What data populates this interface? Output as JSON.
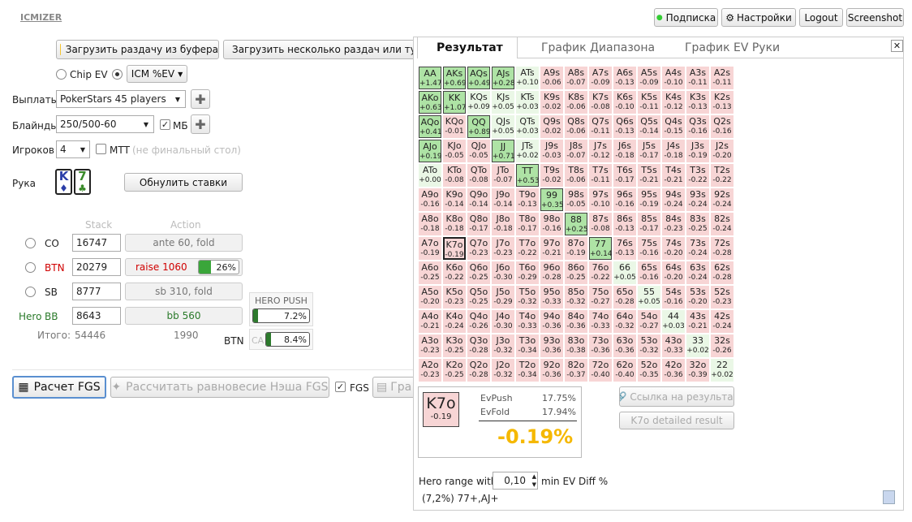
{
  "app_title": "ICMIZER",
  "top": {
    "subscription": "Подписка",
    "settings": "Настройки",
    "logout": "Logout",
    "screenshot": "Screenshot"
  },
  "toolbar": {
    "load_clipboard": "Загрузить раздачу из буфера",
    "load_many": "Загрузить несколько раздач или тур"
  },
  "mode": {
    "chip_ev": "Chip EV",
    "icm_ev": "ICM %EV"
  },
  "payouts": {
    "label": "Выплаты",
    "value": "PokerStars 45 players"
  },
  "blinds": {
    "label": "Блайнды",
    "value": "250/500-60",
    "mb": "МБ"
  },
  "players": {
    "label": "Игроков",
    "value": "4",
    "mtt": "МТТ",
    "mtt_hint": "(не финальный стол)"
  },
  "hand": {
    "label": "Рука",
    "card1_rank": "K",
    "card1_suit": "♦",
    "card2_rank": "7",
    "card2_suit": "♣",
    "reset": "Обнулить ставки"
  },
  "columns": {
    "stack": "Stack",
    "action": "Action"
  },
  "seats": [
    {
      "pos": "CO",
      "stack": "16747",
      "action": "ante 60, fold"
    },
    {
      "pos": "BTN",
      "stack": "20279",
      "action": "raise 1060",
      "pct": "26%",
      "pct_value": 26
    },
    {
      "pos": "SB",
      "stack": "8777",
      "action": "sb 310, fold"
    },
    {
      "pos": "BB",
      "hero": "Hero",
      "stack": "8643",
      "action": "bb 560"
    }
  ],
  "totals": {
    "label": "Итого:",
    "stack": "54446",
    "pot": "1990"
  },
  "hero_push": {
    "title": "HERO PUSH",
    "pct": "7.2%",
    "pct_value": 7.2
  },
  "btn_call": {
    "pos": "BTN",
    "ca": "CA",
    "pct": "8.4%",
    "pct_value": 8.4
  },
  "actions": {
    "calc": "Расчет FGS",
    "nash": "Рассчитать равновесие Нэша FGS",
    "fgs": "FGS",
    "graph": "Гра"
  },
  "tabs": {
    "result": "Результат",
    "range": "График Диапазона",
    "ev": "График EV Руки"
  },
  "grid": [
    [
      [
        "AA",
        "+1.47",
        "g"
      ],
      [
        "AKs",
        "+0.69",
        "g"
      ],
      [
        "AQs",
        "+0.49",
        "g"
      ],
      [
        "AJs",
        "+0.28",
        "g"
      ],
      [
        "ATs",
        "+0.10",
        "w"
      ],
      [
        "A9s",
        "-0.06",
        "r"
      ],
      [
        "A8s",
        "-0.07",
        "r"
      ],
      [
        "A7s",
        "-0.09",
        "r"
      ],
      [
        "A6s",
        "-0.13",
        "r"
      ],
      [
        "A5s",
        "-0.09",
        "r"
      ],
      [
        "A4s",
        "-0.10",
        "r"
      ],
      [
        "A3s",
        "-0.11",
        "r"
      ],
      [
        "A2s",
        "-0.11",
        "r"
      ]
    ],
    [
      [
        "AKo",
        "+0.63",
        "g"
      ],
      [
        "KK",
        "+1.07",
        "g"
      ],
      [
        "KQs",
        "+0.09",
        "w"
      ],
      [
        "KJs",
        "+0.05",
        "w"
      ],
      [
        "KTs",
        "+0.03",
        "w"
      ],
      [
        "K9s",
        "-0.02",
        "r"
      ],
      [
        "K8s",
        "-0.06",
        "r"
      ],
      [
        "K7s",
        "-0.08",
        "r"
      ],
      [
        "K6s",
        "-0.10",
        "r"
      ],
      [
        "K5s",
        "-0.11",
        "r"
      ],
      [
        "K4s",
        "-0.12",
        "r"
      ],
      [
        "K3s",
        "-0.13",
        "r"
      ],
      [
        "K2s",
        "-0.13",
        "r"
      ]
    ],
    [
      [
        "AQo",
        "+0.41",
        "g"
      ],
      [
        "KQo",
        "-0.01",
        "r"
      ],
      [
        "QQ",
        "+0.89",
        "g"
      ],
      [
        "QJs",
        "+0.05",
        "w"
      ],
      [
        "QTs",
        "+0.03",
        "w"
      ],
      [
        "Q9s",
        "-0.02",
        "r"
      ],
      [
        "Q8s",
        "-0.06",
        "r"
      ],
      [
        "Q7s",
        "-0.11",
        "r"
      ],
      [
        "Q6s",
        "-0.13",
        "r"
      ],
      [
        "Q5s",
        "-0.14",
        "r"
      ],
      [
        "Q4s",
        "-0.15",
        "r"
      ],
      [
        "Q3s",
        "-0.16",
        "r"
      ],
      [
        "Q2s",
        "-0.16",
        "r"
      ]
    ],
    [
      [
        "AJo",
        "+0.19",
        "g"
      ],
      [
        "KJo",
        "-0.05",
        "r"
      ],
      [
        "QJo",
        "-0.05",
        "r"
      ],
      [
        "JJ",
        "+0.71",
        "g"
      ],
      [
        "JTs",
        "+0.02",
        "w"
      ],
      [
        "J9s",
        "-0.03",
        "r"
      ],
      [
        "J8s",
        "-0.07",
        "r"
      ],
      [
        "J7s",
        "-0.12",
        "r"
      ],
      [
        "J6s",
        "-0.18",
        "r"
      ],
      [
        "J5s",
        "-0.17",
        "r"
      ],
      [
        "J4s",
        "-0.18",
        "r"
      ],
      [
        "J3s",
        "-0.19",
        "r"
      ],
      [
        "J2s",
        "-0.20",
        "r"
      ]
    ],
    [
      [
        "ATo",
        "+0.00",
        "w"
      ],
      [
        "KTo",
        "-0.08",
        "r"
      ],
      [
        "QTo",
        "-0.08",
        "r"
      ],
      [
        "JTo",
        "-0.07",
        "r"
      ],
      [
        "TT",
        "+0.53",
        "g"
      ],
      [
        "T9s",
        "-0.02",
        "r"
      ],
      [
        "T8s",
        "-0.06",
        "r"
      ],
      [
        "T7s",
        "-0.11",
        "r"
      ],
      [
        "T6s",
        "-0.17",
        "r"
      ],
      [
        "T5s",
        "-0.21",
        "r"
      ],
      [
        "T4s",
        "-0.21",
        "r"
      ],
      [
        "T3s",
        "-0.22",
        "r"
      ],
      [
        "T2s",
        "-0.22",
        "r"
      ]
    ],
    [
      [
        "A9o",
        "-0.16",
        "r"
      ],
      [
        "K9o",
        "-0.14",
        "r"
      ],
      [
        "Q9o",
        "-0.14",
        "r"
      ],
      [
        "J9o",
        "-0.14",
        "r"
      ],
      [
        "T9o",
        "-0.13",
        "r"
      ],
      [
        "99",
        "+0.35",
        "g"
      ],
      [
        "98s",
        "-0.05",
        "r"
      ],
      [
        "97s",
        "-0.10",
        "r"
      ],
      [
        "96s",
        "-0.16",
        "r"
      ],
      [
        "95s",
        "-0.19",
        "r"
      ],
      [
        "94s",
        "-0.24",
        "r"
      ],
      [
        "93s",
        "-0.24",
        "r"
      ],
      [
        "92s",
        "-0.24",
        "r"
      ]
    ],
    [
      [
        "A8o",
        "-0.18",
        "r"
      ],
      [
        "K8o",
        "-0.18",
        "r"
      ],
      [
        "Q8o",
        "-0.17",
        "r"
      ],
      [
        "J8o",
        "-0.18",
        "r"
      ],
      [
        "T8o",
        "-0.17",
        "r"
      ],
      [
        "98o",
        "-0.16",
        "r"
      ],
      [
        "88",
        "+0.25",
        "g"
      ],
      [
        "87s",
        "-0.08",
        "r"
      ],
      [
        "86s",
        "-0.13",
        "r"
      ],
      [
        "85s",
        "-0.17",
        "r"
      ],
      [
        "84s",
        "-0.23",
        "r"
      ],
      [
        "83s",
        "-0.25",
        "r"
      ],
      [
        "82s",
        "-0.24",
        "r"
      ]
    ],
    [
      [
        "A7o",
        "-0.19",
        "r"
      ],
      [
        "K7o",
        "-0.19",
        "sel"
      ],
      [
        "Q7o",
        "-0.23",
        "r"
      ],
      [
        "J7o",
        "-0.23",
        "r"
      ],
      [
        "T7o",
        "-0.22",
        "r"
      ],
      [
        "97o",
        "-0.21",
        "r"
      ],
      [
        "87o",
        "-0.19",
        "r"
      ],
      [
        "77",
        "+0.14",
        "g"
      ],
      [
        "76s",
        "-0.13",
        "r"
      ],
      [
        "75s",
        "-0.16",
        "r"
      ],
      [
        "74s",
        "-0.20",
        "r"
      ],
      [
        "73s",
        "-0.24",
        "r"
      ],
      [
        "72s",
        "-0.28",
        "r"
      ]
    ],
    [
      [
        "A6o",
        "-0.25",
        "r"
      ],
      [
        "K6o",
        "-0.22",
        "r"
      ],
      [
        "Q6o",
        "-0.25",
        "r"
      ],
      [
        "J6o",
        "-0.30",
        "r"
      ],
      [
        "T6o",
        "-0.29",
        "r"
      ],
      [
        "96o",
        "-0.28",
        "r"
      ],
      [
        "86o",
        "-0.25",
        "r"
      ],
      [
        "76o",
        "-0.22",
        "r"
      ],
      [
        "66",
        "+0.05",
        "w"
      ],
      [
        "65s",
        "-0.16",
        "r"
      ],
      [
        "64s",
        "-0.20",
        "r"
      ],
      [
        "63s",
        "-0.24",
        "r"
      ],
      [
        "62s",
        "-0.28",
        "r"
      ]
    ],
    [
      [
        "A5o",
        "-0.20",
        "r"
      ],
      [
        "K5o",
        "-0.23",
        "r"
      ],
      [
        "Q5o",
        "-0.25",
        "r"
      ],
      [
        "J5o",
        "-0.29",
        "r"
      ],
      [
        "T5o",
        "-0.32",
        "r"
      ],
      [
        "95o",
        "-0.33",
        "r"
      ],
      [
        "85o",
        "-0.32",
        "r"
      ],
      [
        "75o",
        "-0.27",
        "r"
      ],
      [
        "65o",
        "-0.28",
        "r"
      ],
      [
        "55",
        "+0.05",
        "w"
      ],
      [
        "54s",
        "-0.16",
        "r"
      ],
      [
        "53s",
        "-0.20",
        "r"
      ],
      [
        "52s",
        "-0.23",
        "r"
      ]
    ],
    [
      [
        "A4o",
        "-0.21",
        "r"
      ],
      [
        "K4o",
        "-0.24",
        "r"
      ],
      [
        "Q4o",
        "-0.26",
        "r"
      ],
      [
        "J4o",
        "-0.30",
        "r"
      ],
      [
        "T4o",
        "-0.33",
        "r"
      ],
      [
        "94o",
        "-0.36",
        "r"
      ],
      [
        "84o",
        "-0.36",
        "r"
      ],
      [
        "74o",
        "-0.33",
        "r"
      ],
      [
        "64o",
        "-0.32",
        "r"
      ],
      [
        "54o",
        "-0.27",
        "r"
      ],
      [
        "44",
        "+0.03",
        "w"
      ],
      [
        "43s",
        "-0.21",
        "r"
      ],
      [
        "42s",
        "-0.24",
        "r"
      ]
    ],
    [
      [
        "A3o",
        "-0.23",
        "r"
      ],
      [
        "K3o",
        "-0.25",
        "r"
      ],
      [
        "Q3o",
        "-0.28",
        "r"
      ],
      [
        "J3o",
        "-0.32",
        "r"
      ],
      [
        "T3o",
        "-0.34",
        "r"
      ],
      [
        "93o",
        "-0.36",
        "r"
      ],
      [
        "83o",
        "-0.38",
        "r"
      ],
      [
        "73o",
        "-0.36",
        "r"
      ],
      [
        "63o",
        "-0.36",
        "r"
      ],
      [
        "53o",
        "-0.32",
        "r"
      ],
      [
        "43o",
        "-0.33",
        "r"
      ],
      [
        "33",
        "+0.02",
        "w"
      ],
      [
        "32s",
        "-0.26",
        "r"
      ]
    ],
    [
      [
        "A2o",
        "-0.23",
        "r"
      ],
      [
        "K2o",
        "-0.25",
        "r"
      ],
      [
        "Q2o",
        "-0.28",
        "r"
      ],
      [
        "J2o",
        "-0.32",
        "r"
      ],
      [
        "T2o",
        "-0.34",
        "r"
      ],
      [
        "92o",
        "-0.36",
        "r"
      ],
      [
        "82o",
        "-0.37",
        "r"
      ],
      [
        "72o",
        "-0.40",
        "r"
      ],
      [
        "62o",
        "-0.40",
        "r"
      ],
      [
        "52o",
        "-0.35",
        "r"
      ],
      [
        "42o",
        "-0.36",
        "r"
      ],
      [
        "32o",
        "-0.39",
        "r"
      ],
      [
        "22",
        "+0.02",
        "w"
      ]
    ]
  ],
  "detail": {
    "hand": "K7o",
    "ev": "-0.19",
    "evpush_label": "EvPush",
    "evpush": "17.75%",
    "evfold_label": "EvFold",
    "evfold": "17.94%",
    "diff": "-0.19%",
    "link": "Ссылка на результат",
    "detailed": "K7o detailed result"
  },
  "footer": {
    "label": "Hero range with",
    "value": "0,10",
    "suffix": "min EV Diff %",
    "range": "(7,2%) 77+,AJ+"
  },
  "colors": {
    "green": "#aee3a5",
    "red": "#f7d5d5",
    "accent": "#f5b800",
    "hero": "#2a7a2a",
    "raise": "#d00000"
  }
}
